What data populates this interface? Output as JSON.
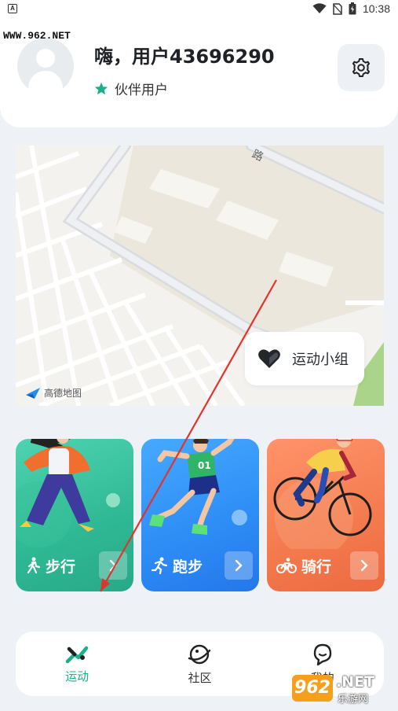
{
  "status_bar": {
    "left_icon": "A",
    "time": "10:38",
    "icons": [
      "wifi-icon",
      "no-sim-icon",
      "battery-icon"
    ]
  },
  "watermark_top": "WWW.962.NET",
  "header": {
    "greeting": "嗨，用户43696290",
    "badge_label": "伙伴用户",
    "badge_icon": "star-icon",
    "settings_icon": "gear-icon"
  },
  "map": {
    "provider_label": "高德地图",
    "road_label": "路",
    "group_button_label": "运动小组",
    "group_button_icon": "heart-icon"
  },
  "sports": [
    {
      "label": "步行",
      "icon": "walk-icon",
      "color": "#2fb894"
    },
    {
      "label": "跑步",
      "icon": "run-icon",
      "color": "#2d8cf5"
    },
    {
      "label": "骑行",
      "icon": "bike-icon",
      "color": "#f47a4e"
    }
  ],
  "bottom_nav": {
    "items": [
      {
        "label": "运动",
        "icon": "sport-icon",
        "active": true
      },
      {
        "label": "社区",
        "icon": "planet-icon",
        "active": false
      },
      {
        "label": "我的",
        "icon": "face-icon",
        "active": false
      }
    ]
  },
  "watermark_bottom": {
    "box": "962",
    "net": ".NET",
    "sub": "乐游网"
  },
  "colors": {
    "accent": "#19b08a",
    "background": "#eef2f6"
  }
}
